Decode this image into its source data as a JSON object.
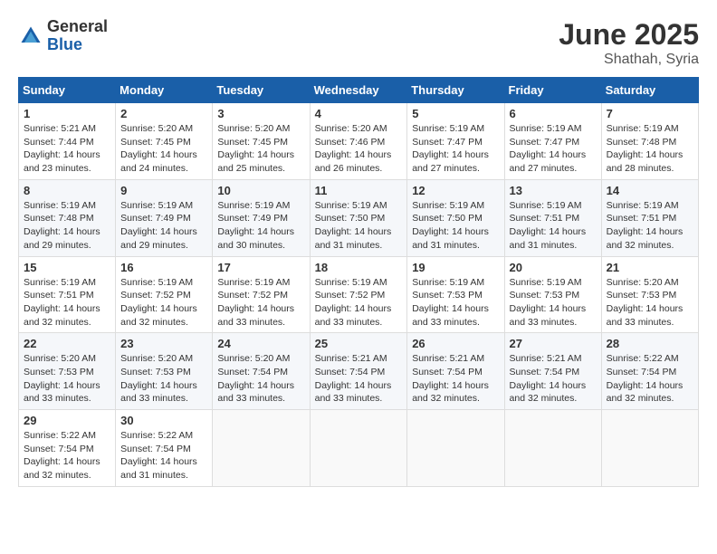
{
  "logo": {
    "general": "General",
    "blue": "Blue"
  },
  "title": {
    "month_year": "June 2025",
    "location": "Shathah, Syria"
  },
  "headers": [
    "Sunday",
    "Monday",
    "Tuesday",
    "Wednesday",
    "Thursday",
    "Friday",
    "Saturday"
  ],
  "weeks": [
    [
      {
        "day": "1",
        "sunrise": "Sunrise: 5:21 AM",
        "sunset": "Sunset: 7:44 PM",
        "daylight": "Daylight: 14 hours and 23 minutes."
      },
      {
        "day": "2",
        "sunrise": "Sunrise: 5:20 AM",
        "sunset": "Sunset: 7:45 PM",
        "daylight": "Daylight: 14 hours and 24 minutes."
      },
      {
        "day": "3",
        "sunrise": "Sunrise: 5:20 AM",
        "sunset": "Sunset: 7:45 PM",
        "daylight": "Daylight: 14 hours and 25 minutes."
      },
      {
        "day": "4",
        "sunrise": "Sunrise: 5:20 AM",
        "sunset": "Sunset: 7:46 PM",
        "daylight": "Daylight: 14 hours and 26 minutes."
      },
      {
        "day": "5",
        "sunrise": "Sunrise: 5:19 AM",
        "sunset": "Sunset: 7:47 PM",
        "daylight": "Daylight: 14 hours and 27 minutes."
      },
      {
        "day": "6",
        "sunrise": "Sunrise: 5:19 AM",
        "sunset": "Sunset: 7:47 PM",
        "daylight": "Daylight: 14 hours and 27 minutes."
      },
      {
        "day": "7",
        "sunrise": "Sunrise: 5:19 AM",
        "sunset": "Sunset: 7:48 PM",
        "daylight": "Daylight: 14 hours and 28 minutes."
      }
    ],
    [
      {
        "day": "8",
        "sunrise": "Sunrise: 5:19 AM",
        "sunset": "Sunset: 7:48 PM",
        "daylight": "Daylight: 14 hours and 29 minutes."
      },
      {
        "day": "9",
        "sunrise": "Sunrise: 5:19 AM",
        "sunset": "Sunset: 7:49 PM",
        "daylight": "Daylight: 14 hours and 29 minutes."
      },
      {
        "day": "10",
        "sunrise": "Sunrise: 5:19 AM",
        "sunset": "Sunset: 7:49 PM",
        "daylight": "Daylight: 14 hours and 30 minutes."
      },
      {
        "day": "11",
        "sunrise": "Sunrise: 5:19 AM",
        "sunset": "Sunset: 7:50 PM",
        "daylight": "Daylight: 14 hours and 31 minutes."
      },
      {
        "day": "12",
        "sunrise": "Sunrise: 5:19 AM",
        "sunset": "Sunset: 7:50 PM",
        "daylight": "Daylight: 14 hours and 31 minutes."
      },
      {
        "day": "13",
        "sunrise": "Sunrise: 5:19 AM",
        "sunset": "Sunset: 7:51 PM",
        "daylight": "Daylight: 14 hours and 31 minutes."
      },
      {
        "day": "14",
        "sunrise": "Sunrise: 5:19 AM",
        "sunset": "Sunset: 7:51 PM",
        "daylight": "Daylight: 14 hours and 32 minutes."
      }
    ],
    [
      {
        "day": "15",
        "sunrise": "Sunrise: 5:19 AM",
        "sunset": "Sunset: 7:51 PM",
        "daylight": "Daylight: 14 hours and 32 minutes."
      },
      {
        "day": "16",
        "sunrise": "Sunrise: 5:19 AM",
        "sunset": "Sunset: 7:52 PM",
        "daylight": "Daylight: 14 hours and 32 minutes."
      },
      {
        "day": "17",
        "sunrise": "Sunrise: 5:19 AM",
        "sunset": "Sunset: 7:52 PM",
        "daylight": "Daylight: 14 hours and 33 minutes."
      },
      {
        "day": "18",
        "sunrise": "Sunrise: 5:19 AM",
        "sunset": "Sunset: 7:52 PM",
        "daylight": "Daylight: 14 hours and 33 minutes."
      },
      {
        "day": "19",
        "sunrise": "Sunrise: 5:19 AM",
        "sunset": "Sunset: 7:53 PM",
        "daylight": "Daylight: 14 hours and 33 minutes."
      },
      {
        "day": "20",
        "sunrise": "Sunrise: 5:19 AM",
        "sunset": "Sunset: 7:53 PM",
        "daylight": "Daylight: 14 hours and 33 minutes."
      },
      {
        "day": "21",
        "sunrise": "Sunrise: 5:20 AM",
        "sunset": "Sunset: 7:53 PM",
        "daylight": "Daylight: 14 hours and 33 minutes."
      }
    ],
    [
      {
        "day": "22",
        "sunrise": "Sunrise: 5:20 AM",
        "sunset": "Sunset: 7:53 PM",
        "daylight": "Daylight: 14 hours and 33 minutes."
      },
      {
        "day": "23",
        "sunrise": "Sunrise: 5:20 AM",
        "sunset": "Sunset: 7:53 PM",
        "daylight": "Daylight: 14 hours and 33 minutes."
      },
      {
        "day": "24",
        "sunrise": "Sunrise: 5:20 AM",
        "sunset": "Sunset: 7:54 PM",
        "daylight": "Daylight: 14 hours and 33 minutes."
      },
      {
        "day": "25",
        "sunrise": "Sunrise: 5:21 AM",
        "sunset": "Sunset: 7:54 PM",
        "daylight": "Daylight: 14 hours and 33 minutes."
      },
      {
        "day": "26",
        "sunrise": "Sunrise: 5:21 AM",
        "sunset": "Sunset: 7:54 PM",
        "daylight": "Daylight: 14 hours and 32 minutes."
      },
      {
        "day": "27",
        "sunrise": "Sunrise: 5:21 AM",
        "sunset": "Sunset: 7:54 PM",
        "daylight": "Daylight: 14 hours and 32 minutes."
      },
      {
        "day": "28",
        "sunrise": "Sunrise: 5:22 AM",
        "sunset": "Sunset: 7:54 PM",
        "daylight": "Daylight: 14 hours and 32 minutes."
      }
    ],
    [
      {
        "day": "29",
        "sunrise": "Sunrise: 5:22 AM",
        "sunset": "Sunset: 7:54 PM",
        "daylight": "Daylight: 14 hours and 32 minutes."
      },
      {
        "day": "30",
        "sunrise": "Sunrise: 5:22 AM",
        "sunset": "Sunset: 7:54 PM",
        "daylight": "Daylight: 14 hours and 31 minutes."
      },
      null,
      null,
      null,
      null,
      null
    ]
  ]
}
